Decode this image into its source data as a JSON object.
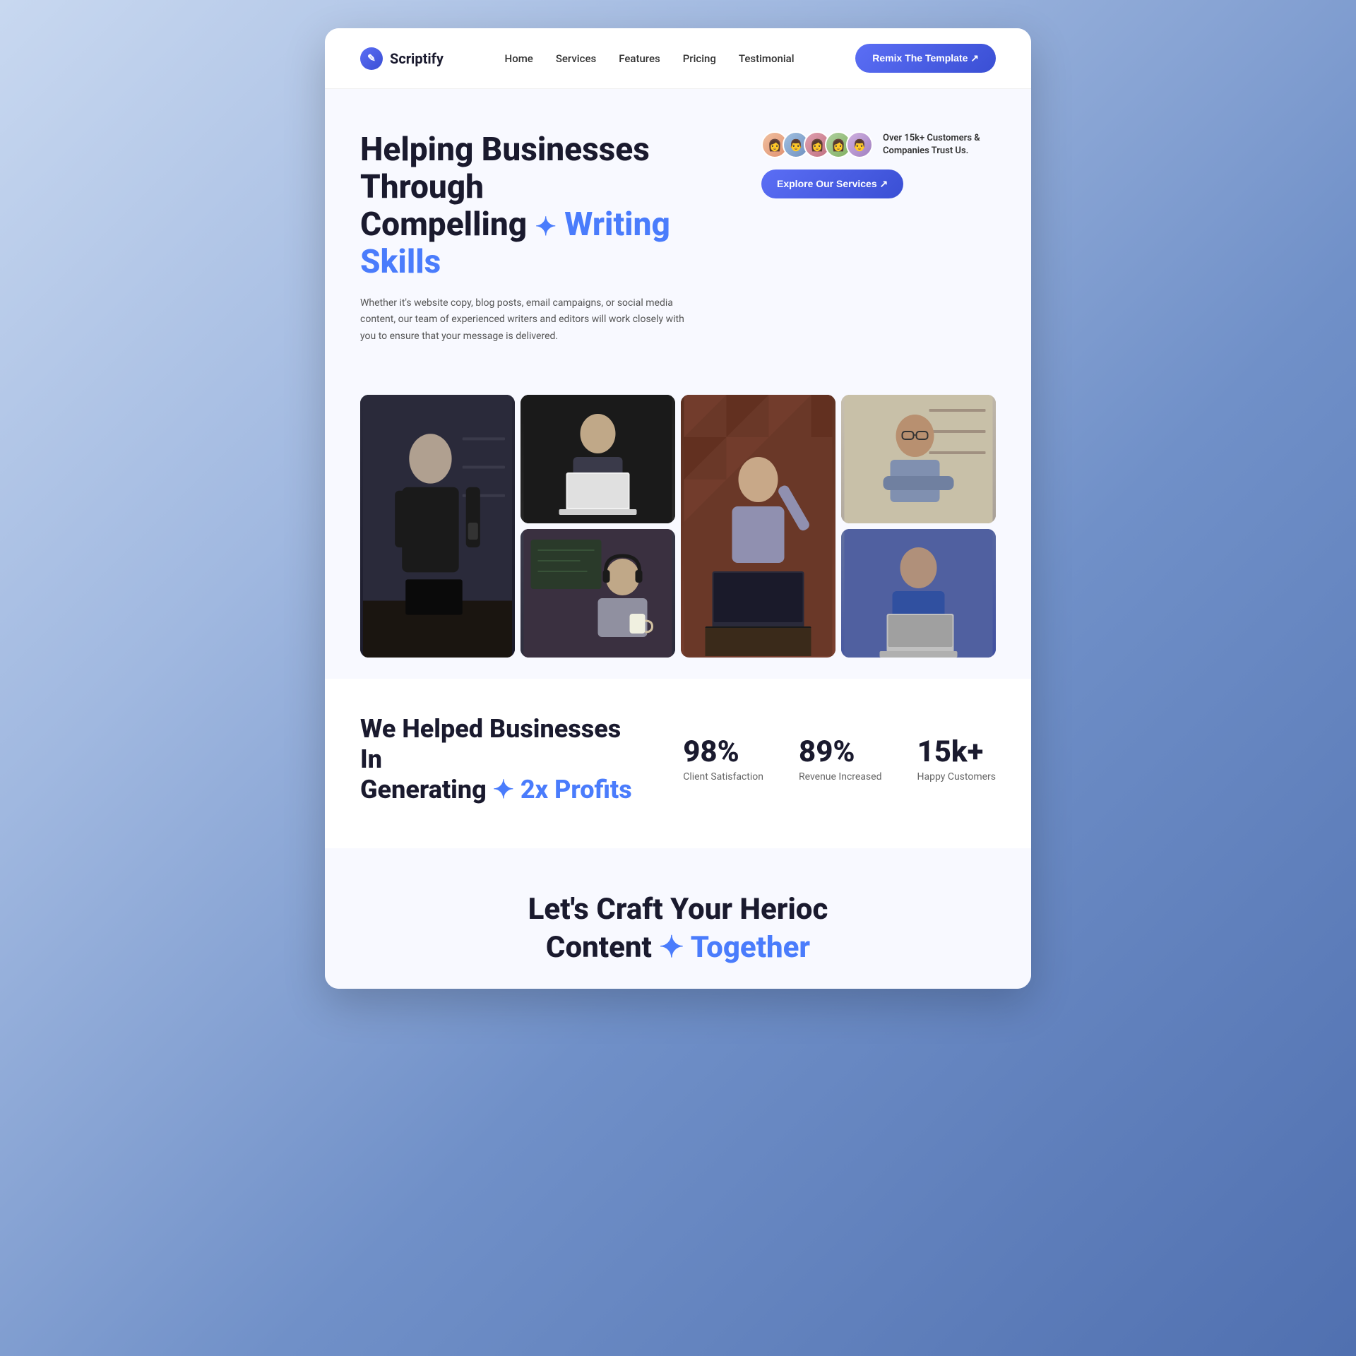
{
  "brand": {
    "name": "Scriptify",
    "icon_char": "✎"
  },
  "nav": {
    "links": [
      {
        "label": "Home",
        "href": "#"
      },
      {
        "label": "Services",
        "href": "#"
      },
      {
        "label": "Features",
        "href": "#"
      },
      {
        "label": "Pricing",
        "href": "#"
      },
      {
        "label": "Testimonial",
        "href": "#"
      }
    ],
    "cta_label": "Remix The Template ↗"
  },
  "hero": {
    "title_line1": "Helping Businesses Through",
    "title_line2_plain": "Compelling",
    "title_sparkle": "✦",
    "title_highlight": "Writing Skills",
    "description": "Whether it's website copy, blog posts, email campaigns, or social media content, our team of experienced writers and editors will work closely with you to ensure that your message is delivered.",
    "trust_text": "Over 15k+ Customers & Companies Trust Us.",
    "explore_btn": "Explore Our Services ↗"
  },
  "stats": {
    "title_line1": "We Helped Businesses In",
    "title_line2_plain": "Generating",
    "title_sparkle": "✦",
    "title_highlight": "2x Profits",
    "items": [
      {
        "value": "98%",
        "label": "Client Satisfaction"
      },
      {
        "value": "89%",
        "label": "Revenue Increased"
      },
      {
        "value": "15k+",
        "label": "Happy Customers"
      }
    ]
  },
  "bottom": {
    "title_line1": "Let's Craft Your Herioc",
    "title_line2_plain": "Content",
    "title_sparkle": "✦",
    "title_highlight": "Together"
  },
  "colors": {
    "accent": "#4a7cfc",
    "accent_dark": "#3a4fd4",
    "text_dark": "#1a1a2e"
  }
}
